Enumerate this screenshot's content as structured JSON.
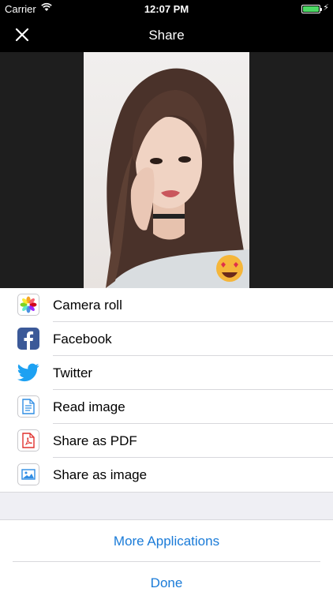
{
  "status_bar": {
    "carrier": "Carrier",
    "time": "12:07 PM"
  },
  "nav": {
    "title": "Share",
    "close_icon": "close-icon"
  },
  "share_options": [
    {
      "label": "Camera roll",
      "icon": "photos-icon"
    },
    {
      "label": "Facebook",
      "icon": "facebook-icon",
      "color": "#3b5998"
    },
    {
      "label": "Twitter",
      "icon": "twitter-icon",
      "color": "#1da1f2"
    },
    {
      "label": "Read image",
      "icon": "document-icon",
      "color": "#2f8de4"
    },
    {
      "label": "Share as PDF",
      "icon": "pdf-icon",
      "color": "#e0312d"
    },
    {
      "label": "Share as image",
      "icon": "image-icon",
      "color": "#2f8de4"
    }
  ],
  "actions": {
    "more": "More Applications",
    "done": "Done"
  },
  "colors": {
    "accent": "#1a7bd8",
    "battery": "#4cd964"
  }
}
